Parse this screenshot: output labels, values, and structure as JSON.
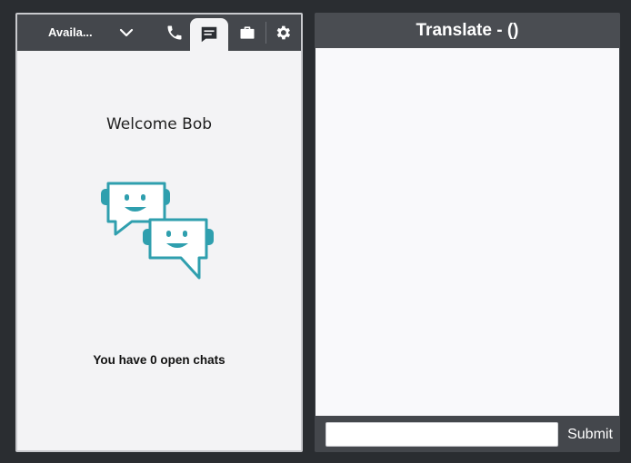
{
  "ccp": {
    "toolbar": {
      "status_label": "Availa...",
      "icons": [
        "chevron-down-icon",
        "phone-icon",
        "chat-icon",
        "briefcase-icon",
        "gear-icon"
      ],
      "active_tab": "chat"
    },
    "welcome_text": "Welcome Bob",
    "open_chats": {
      "prefix": "You have ",
      "count": "0",
      "suffix": " open chats"
    },
    "illustration": "chat-bubbles-illustration"
  },
  "translate": {
    "title": "Translate - ()",
    "input_value": "",
    "submit_label": "Submit"
  },
  "colors": {
    "background": "#2a2d31",
    "toolbar": "#44474c",
    "accent_teal": "#2f9fae",
    "panel_bg": "#f3f3f5",
    "translate_bg": "#f9f9fb"
  }
}
